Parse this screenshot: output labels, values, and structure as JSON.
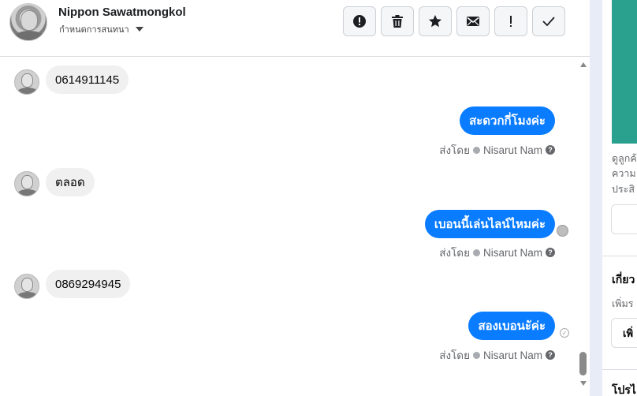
{
  "header": {
    "contact_name": "Nippon Sawatmongkol",
    "status_dropdown_label": "กำหนดการสนทนา"
  },
  "toolbar": {
    "buttons": [
      {
        "name": "spam-button",
        "icon": "alert-circle-icon",
        "glyph": "!"
      },
      {
        "name": "delete-button",
        "icon": "trash-icon"
      },
      {
        "name": "star-button",
        "icon": "star-icon"
      },
      {
        "name": "mark-unread-button",
        "icon": "envelope-icon"
      },
      {
        "name": "follow-up-button",
        "icon": "exclamation-icon",
        "glyph": "!"
      },
      {
        "name": "done-button",
        "icon": "check-icon"
      }
    ]
  },
  "messages": [
    {
      "direction": "in",
      "text": "0614911145"
    },
    {
      "direction": "out",
      "text": "สะดวกกี่โมงค่ะ",
      "sent_by_label": "ส่งโดย",
      "sender": "Nisarut Nam"
    },
    {
      "direction": "in",
      "text": "ตลอด"
    },
    {
      "direction": "out",
      "text": "เบอนนี้เล่นไลน์ไหมค่ะ",
      "sent_by_label": "ส่งโดย",
      "sender": "Nisarut Nam"
    },
    {
      "direction": "in",
      "text": "0869294945"
    },
    {
      "direction": "out",
      "text": "สองเบอนะัค่ะ",
      "sent_by_label": "ส่งโดย",
      "sender": "Nisarut Nam"
    }
  ],
  "right_panel": {
    "text_line1": "ดูลูกค้",
    "text_line2": "ความ",
    "text_line3": "ประสิ",
    "section_heading": "เกี่ยว",
    "section_text": "เพิ่มร",
    "section_button": "เพิ่",
    "bottom_heading": "โปรไ"
  },
  "colors": {
    "outgoing_bubble": "#0a7cff",
    "incoming_bubble": "#f0f0f0",
    "panel_accent": "#2aa08f"
  }
}
